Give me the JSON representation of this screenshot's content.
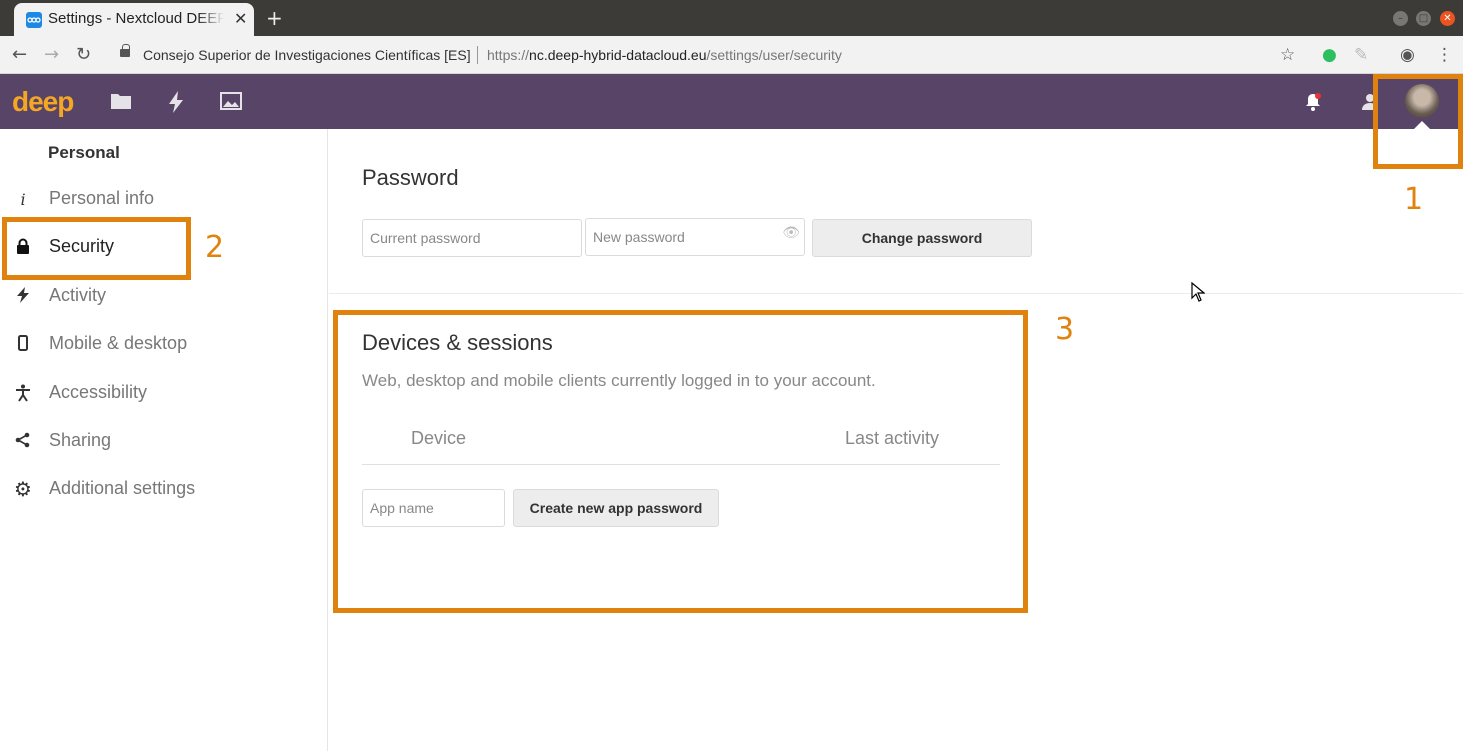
{
  "browser": {
    "tab_title": "Settings - Nextcloud DEEP",
    "tab_close": "✕",
    "new_tab": "+",
    "url_org": "Consejo Superior de Investigaciones Científicas [ES]",
    "url_prefix": "https://",
    "url_host": "nc.deep-hybrid-datacloud.eu",
    "url_path": "/settings/user/security"
  },
  "header": {
    "logo": "deep"
  },
  "sidebar": {
    "heading": "Personal",
    "items": [
      {
        "label": "Personal info",
        "icon": "info-icon"
      },
      {
        "label": "Security",
        "icon": "lock-icon"
      },
      {
        "label": "Activity",
        "icon": "lightning-icon"
      },
      {
        "label": "Mobile & desktop",
        "icon": "phone-icon"
      },
      {
        "label": "Accessibility",
        "icon": "accessibility-icon"
      },
      {
        "label": "Sharing",
        "icon": "share-icon"
      },
      {
        "label": "Additional settings",
        "icon": "gear-icon"
      }
    ]
  },
  "password": {
    "title": "Password",
    "current_placeholder": "Current password",
    "new_placeholder": "New password",
    "change_button": "Change password"
  },
  "devices": {
    "title": "Devices & sessions",
    "hint": "Web, desktop and mobile clients currently logged in to your account.",
    "col_device": "Device",
    "col_last_activity": "Last activity",
    "app_name_placeholder": "App name",
    "create_button": "Create new app password"
  },
  "annotations": {
    "n1": "1",
    "n2": "2",
    "n3": "3",
    "color": "#e0830e"
  },
  "colors": {
    "header_bg": "#574467",
    "logo": "#f5a623"
  }
}
